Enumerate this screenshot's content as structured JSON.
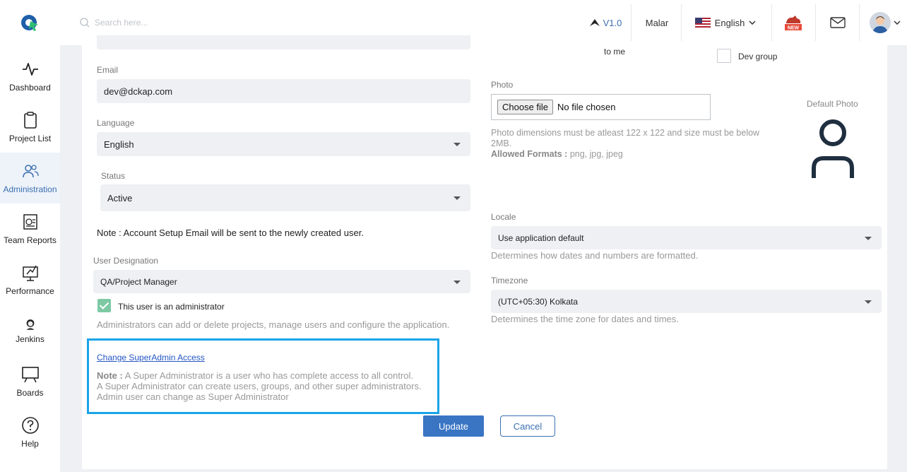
{
  "header": {
    "search_placeholder": "Search here...",
    "version": "V1.0",
    "username": "Malar",
    "language": "English",
    "new_badge": "NEW"
  },
  "sidebar": {
    "items": [
      {
        "label": "Dashboard",
        "icon": "activity-icon"
      },
      {
        "label": "Project List",
        "icon": "clipboard-icon"
      },
      {
        "label": "Administration",
        "icon": "users-icon"
      },
      {
        "label": "Team Reports",
        "icon": "report-icon"
      },
      {
        "label": "Performance",
        "icon": "performance-icon"
      },
      {
        "label": "Jenkins",
        "icon": "jenkins-icon"
      },
      {
        "label": "Boards",
        "icon": "board-icon"
      },
      {
        "label": "Help",
        "icon": "help-icon"
      }
    ],
    "active_index": 2
  },
  "form": {
    "to_me": "to me",
    "dev_group_label": "Dev group",
    "dev_group_checked": false,
    "email_label": "Email",
    "email_value": "dev@dckap.com",
    "language_label": "Language",
    "language_value": "English",
    "status_label": "Status",
    "status_value": "Active",
    "note_setup": "Note : Account Setup Email will be sent to the newly created user.",
    "designation_label": "User Designation",
    "designation_value": "QA/Project Manager",
    "admin_checkbox_label": "This user is an administrator",
    "admin_checked": true,
    "admin_help": "Administrators can add or delete projects, manage users and configure the application.",
    "photo_label": "Photo",
    "file_button": "Choose file",
    "file_status": "No file chosen",
    "photo_help_1": "Photo dimensions must be atleast 122 x 122 and size must be below",
    "photo_help_2": "2MB.",
    "allowed_formats_label": "Allowed Formats :",
    "allowed_formats_value": "png, jpg, jpeg",
    "default_photo_label": "Default Photo",
    "locale_label": "Locale",
    "locale_value": "Use application default",
    "locale_help": "Determines how dates and numbers are formatted.",
    "timezone_label": "Timezone",
    "timezone_value": "(UTC+05:30) Kolkata",
    "timezone_help": "Determines the time zone for dates and times."
  },
  "superadmin": {
    "link": "Change SuperAdmin Access",
    "note_label": "Note :",
    "note_line1": "A Super Administrator is a user who has complete access to all control.",
    "note_line2": "A Super Administrator can create users, groups, and other super administrators.",
    "note_line3": "Admin user can change as Super Administrator"
  },
  "actions": {
    "update": "Update",
    "cancel": "Cancel"
  },
  "colors": {
    "accent": "#3a75c4",
    "highlight_border": "#1aa3e8",
    "check_green": "#7dc9a4"
  }
}
